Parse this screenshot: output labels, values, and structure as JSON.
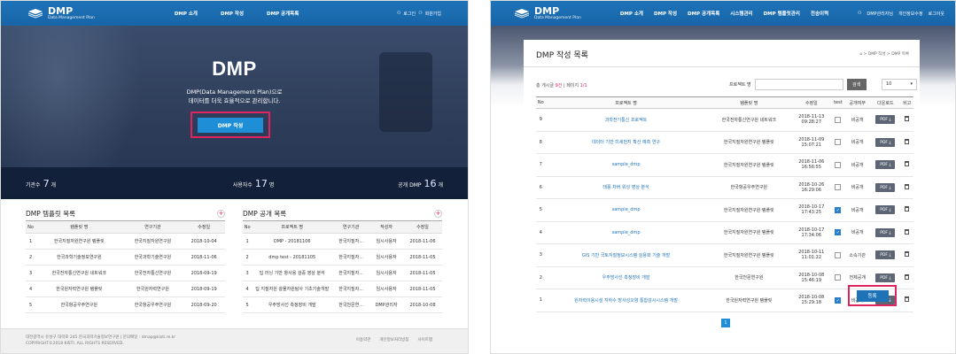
{
  "brand": {
    "title": "DMP",
    "subtitle": "Data Management Plan"
  },
  "left": {
    "nav": [
      "DMP 소개",
      "DMP 작성",
      "DMP 공개목록"
    ],
    "util": {
      "login": "로그인",
      "join": "회원가입"
    },
    "hero": {
      "title": "DMP",
      "line1": "DMP(Data Management Plan)으로",
      "line2": "데이터를 더욱 효율적으로 관리합니다.",
      "button": "DMP 작성"
    },
    "stats": {
      "org_label": "기관수",
      "org_value": "7",
      "org_unit": "개",
      "user_label": "사용자수",
      "user_value": "17",
      "user_unit": "명",
      "pub_label": "공개 DMP",
      "pub_value": "16",
      "pub_unit": "개"
    },
    "templates": {
      "title": "DMP 템플릿 목록",
      "headers": [
        "No",
        "템플릿 명",
        "연구기관",
        "수정일"
      ],
      "rows": [
        [
          "1",
          "한국지질자원연구원 템플릿",
          "한국지질자원연구원",
          "2018-10-04"
        ],
        [
          "2",
          "한국과학기술정보연구원",
          "한국과학기술연구원",
          "2018-11-06"
        ],
        [
          "3",
          "한국전자통신연구원 네트워크",
          "한국전자통신연구원",
          "2018-09-19"
        ],
        [
          "4",
          "한국원자력연구원 템플릿",
          "한국원자력연구원",
          "2018-09-19"
        ],
        [
          "5",
          "한국항공우주연구원",
          "한국항공우주연구원",
          "2018-09-20"
        ]
      ]
    },
    "public": {
      "title": "DMP 공개 목록",
      "headers": [
        "No",
        "프로젝트 명",
        "연구기관",
        "작성자",
        "수정일"
      ],
      "rows": [
        [
          "1",
          "DMP - 20181106",
          "한국지질자...",
          "임시사용자",
          "2018-11-06"
        ],
        [
          "2",
          "dmp test - 20181105",
          "한국지질자...",
          "임시사용자",
          "2018-11-05"
        ],
        [
          "3",
          "딥 러닝 기반 항사용 검증 영상 분석",
          "한국지질자...",
          "임시사용자",
          "2018-11-05"
        ],
        [
          "4",
          "딥 지질자원 광물자원탐사 기초기술개발",
          "한국지질자...",
          "임시사용자",
          "2018-11-05"
        ],
        [
          "5",
          "우주방사선 측정장비 개발",
          "한국천문연...",
          "DMP관리자",
          "2018-10-08"
        ]
      ]
    },
    "footer": {
      "line1": "대전광역시 유성구 대학로 245 한국과학기술정보연구원  |  문의메일 : dmap@kisti.re.kr",
      "line2": "COPYRIGHT©2018 KISTI. ALL RIGHTS RESERVED.",
      "links": [
        "이용약관",
        "개인정보처리방침",
        "사이트맵"
      ]
    }
  },
  "right": {
    "nav": [
      "DMP 소개",
      "DMP 작성",
      "DMP 공개목록",
      "시스템관리",
      "DMP 템플릿관리",
      "전송이력"
    ],
    "util": {
      "user": "DMP관리자님",
      "info": "개인정보수정",
      "logout": "로그아웃"
    },
    "title": "DMP 작성 목록",
    "breadcrumb": "⌂ > DMP 작성 > DMP 목록",
    "count_label": "총 게시글",
    "count_value": "9건",
    "page_label": "페이지",
    "page_value": "1/1",
    "search_label": "프로젝트 명",
    "search_button": "검색",
    "per_page": "10",
    "headers": [
      "No",
      "프로젝트 명",
      "템플릿 명",
      "수정일",
      "test",
      "공개여부",
      "다운로드",
      "비고"
    ],
    "rows": [
      {
        "no": "9",
        "name": "과학전기통신 프로젝트",
        "tpl": "한국전자통신연구원 네트워크",
        "date": "2018-11-13",
        "time": "09:28:27",
        "test": false,
        "pub": "비공개"
      },
      {
        "no": "8",
        "name": "데이터 기반 미세먼지 확산 예측 연구",
        "tpl": "한국지질자원연구원 템플릿",
        "date": "2018-11-09",
        "time": "15:07:21",
        "test": false,
        "pub": "비공개"
      },
      {
        "no": "7",
        "name": "sample_dmp",
        "tpl": "한국지질자원연구원 템플릿",
        "date": "2018-11-06",
        "time": "16:56:55",
        "test": false,
        "pub": "비공개"
      },
      {
        "no": "6",
        "name": "태풍 차버 위성 영상 분석",
        "tpl": "한국항공우주연구원",
        "date": "2018-10-26",
        "time": "16:29:06",
        "test": false,
        "pub": "비공개"
      },
      {
        "no": "5",
        "name": "sample_dmp",
        "tpl": "한국지질자원연구원 템플릿",
        "date": "2018-10-17",
        "time": "17:43:25",
        "test": true,
        "pub": "비공개"
      },
      {
        "no": "4",
        "name": "sample_dmp",
        "tpl": "한국지질자원연구원 템플릿",
        "date": "2018-10-17",
        "time": "17:34:06",
        "test": true,
        "pub": "비공개"
      },
      {
        "no": "3",
        "name": "GIS 기반 국토지질정보시스템 실용화 기술 개발",
        "tpl": "한국지질자원연구원 템플릿",
        "date": "2018-10-11",
        "time": "11:01:22",
        "test": false,
        "pub": "소속기관"
      },
      {
        "no": "2",
        "name": "우주방사선 측정장비 개발",
        "tpl": "한국천문연구원",
        "date": "2018-10-08",
        "time": "15:46:19",
        "test": false,
        "pub": "전체공개"
      },
      {
        "no": "1",
        "name": "원자력이용시설 지하수 방사성오염 통합감시시스템 개발",
        "tpl": "한국원자력연구원 템플릿",
        "date": "2018-10-08",
        "time": "15:29:18",
        "test": true,
        "pub": "비공개"
      }
    ],
    "pdf_label": "PDF ⤓",
    "pagination": "1",
    "register": "등록"
  }
}
